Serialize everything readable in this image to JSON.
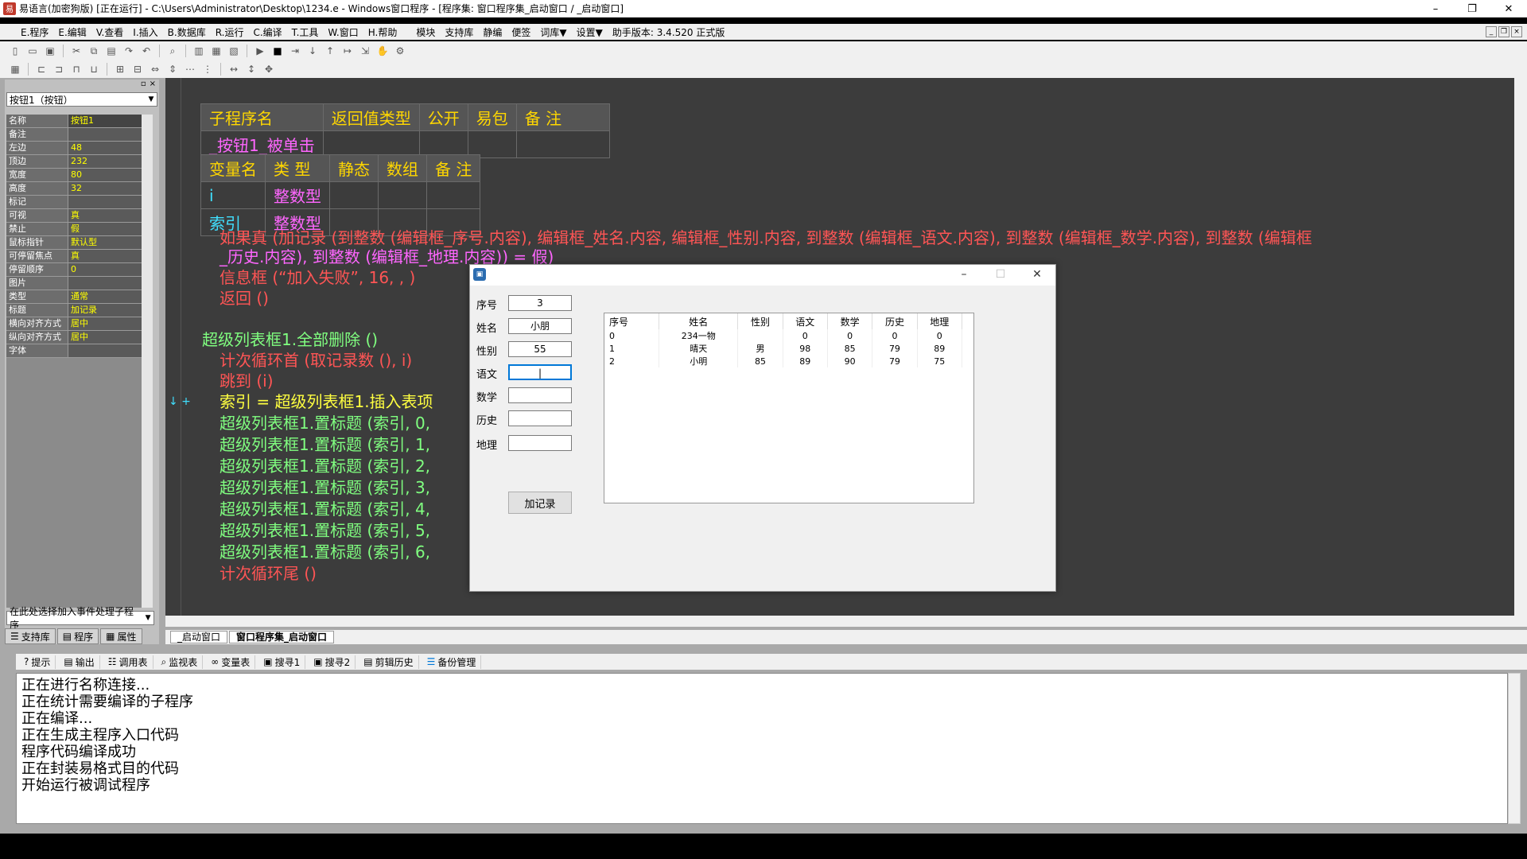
{
  "window": {
    "title": "易语言(加密狗版) [正在运行] - C:\\Users\\Administrator\\Desktop\\1234.e - Windows窗口程序 - [程序集: 窗口程序集_启动窗口 / _启动窗口]",
    "minimize": "–",
    "restore": "❐",
    "close": "✕"
  },
  "menu": {
    "items": [
      "E.程序",
      "E.编辑",
      "V.查看",
      "I.插入",
      "B.数据库",
      "R.运行",
      "C.编译",
      "T.工具",
      "W.窗口",
      "H.帮助",
      "模块",
      "支持库",
      "静编",
      "便签",
      "词库▼",
      "设置▼",
      "助手版本: 3.4.520 正式版"
    ]
  },
  "left_panel": {
    "combo": "按钮1（按钮）",
    "properties": [
      {
        "k": "名称",
        "v": "按钮1"
      },
      {
        "k": "备注",
        "v": ""
      },
      {
        "k": "左边",
        "v": "48"
      },
      {
        "k": "顶边",
        "v": "232"
      },
      {
        "k": "宽度",
        "v": "80"
      },
      {
        "k": "高度",
        "v": "32"
      },
      {
        "k": "标记",
        "v": ""
      },
      {
        "k": "可视",
        "v": "真"
      },
      {
        "k": "禁止",
        "v": "假"
      },
      {
        "k": "鼠标指针",
        "v": "默认型"
      },
      {
        "k": "可停留焦点",
        "v": "真"
      },
      {
        "k": "停留顺序",
        "v": "0"
      },
      {
        "k": "图片",
        "v": ""
      },
      {
        "k": "类型",
        "v": "通常"
      },
      {
        "k": "标题",
        "v": "加记录"
      },
      {
        "k": "横向对齐方式",
        "v": "居中"
      },
      {
        "k": "纵向对齐方式",
        "v": "居中"
      },
      {
        "k": "字体",
        "v": ""
      }
    ],
    "bottom_combo": "在此处选择加入事件处理子程序",
    "tabs": [
      "支持库",
      "程序",
      "属性"
    ]
  },
  "code": {
    "sub_header": [
      "子程序名",
      "返回值类型",
      "公开",
      "易包",
      "备 注"
    ],
    "sub_name": "_按钮1_被单击",
    "var_header": [
      "变量名",
      "类 型",
      "静态",
      "数组",
      "备 注"
    ],
    "vars": [
      {
        "name": "i",
        "type": "整数型"
      },
      {
        "name": "索引",
        "type": "整数型"
      }
    ],
    "line1": "如果真 (加记录 (到整数 (编辑框_序号.内容), 编辑框_姓名.内容, 编辑框_性别.内容, 到整数 (编辑框_语文.内容), 到整数 (编辑框_数学.内容), 到整数 (编辑框",
    "line2": "_历史.内容), 到整数 (编辑框_地理.内容)) = 假)",
    "line3": "信息框 (“加入失败”, 16, , )",
    "line4": "返回 ()",
    "line5": "超级列表框1.全部删除 ()",
    "line6": "计次循环首 (取记录数 (), i)",
    "line7": "跳到 (i)",
    "line8": "索引 = 超级列表框1.插入表项",
    "lines_title": [
      "超级列表框1.置标题 (索引, 0,",
      "超级列表框1.置标题 (索引, 1,",
      "超级列表框1.置标题 (索引, 2,",
      "超级列表框1.置标题 (索引, 3,",
      "超级列表框1.置标题 (索引, 4,",
      "超级列表框1.置标题 (索引, 5,",
      "超级列表框1.置标题 (索引, 6,"
    ],
    "line_end": "计次循环尾 ()"
  },
  "doc_tabs": [
    "_启动窗口",
    "窗口程序集_启动窗口"
  ],
  "output_tabs": [
    "提示",
    "输出",
    "调用表",
    "监视表",
    "变量表",
    "搜寻1",
    "搜寻2",
    "剪辑历史",
    "备份管理"
  ],
  "output_lines": [
    "正在进行名称连接...",
    "正在统计需要编译的子程序",
    "正在编译...",
    "正在生成主程序入口代码",
    "程序代码编译成功",
    "正在封装易格式目的代码",
    "开始运行被调试程序"
  ],
  "dialog": {
    "fields": [
      {
        "label": "序号",
        "value": "3"
      },
      {
        "label": "姓名",
        "value": "小朋"
      },
      {
        "label": "性别",
        "value": "55"
      },
      {
        "label": "语文",
        "value": "|"
      },
      {
        "label": "数学",
        "value": ""
      },
      {
        "label": "历史",
        "value": ""
      },
      {
        "label": "地理",
        "value": ""
      }
    ],
    "button": "加记录",
    "grid_headers": [
      "序号",
      "姓名",
      "性别",
      "语文",
      "数学",
      "历史",
      "地理"
    ],
    "grid_rows": [
      [
        "0",
        "234一物",
        "",
        "0",
        "0",
        "0",
        "0"
      ],
      [
        "1",
        "晴天",
        "男",
        "98",
        "85",
        "79",
        "89"
      ],
      [
        "2",
        "小明",
        "85",
        "89",
        "90",
        "79",
        "75"
      ]
    ]
  }
}
